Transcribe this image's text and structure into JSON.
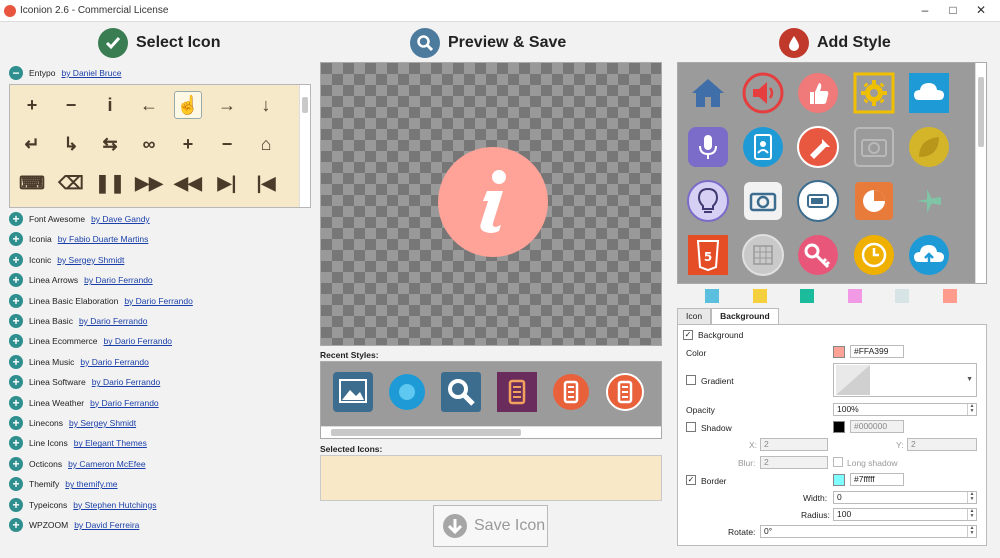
{
  "window": {
    "title": "Iconion 2.6 - Commercial License",
    "minimize": "–",
    "maximize": "□",
    "close": "✕"
  },
  "sections": {
    "select": "Select Icon",
    "preview": "Preview & Save",
    "style": "Add Style"
  },
  "icon_sets": [
    {
      "name": "Entypo",
      "author": "by Daniel Bruce",
      "expanded": true
    },
    {
      "name": "Font Awesome",
      "author": "by Dave Gandy"
    },
    {
      "name": "Iconia",
      "author": "by Fabio Duarte Martins"
    },
    {
      "name": "Iconic",
      "author": "by Sergey Shmidt"
    },
    {
      "name": "Linea Arrows",
      "author": "by Dario Ferrando"
    },
    {
      "name": "Linea Basic Elaboration",
      "author": "by Dario Ferrando"
    },
    {
      "name": "Linea Basic",
      "author": "by Dario Ferrando"
    },
    {
      "name": "Linea Ecommerce",
      "author": "by Dario Ferrando"
    },
    {
      "name": "Linea Music",
      "author": "by Dario Ferrando"
    },
    {
      "name": "Linea Software",
      "author": "by Dario Ferrando"
    },
    {
      "name": "Linea Weather",
      "author": "by Dario Ferrando"
    },
    {
      "name": "Linecons",
      "author": "by Sergey Shmidt"
    },
    {
      "name": "Line Icons",
      "author": "by Elegant Themes"
    },
    {
      "name": "Octicons",
      "author": "by Cameron McEfee"
    },
    {
      "name": "Themify",
      "author": "by themify.me"
    },
    {
      "name": "Typeicons",
      "author": "by Stephen Hutchings"
    },
    {
      "name": "WPZOOM",
      "author": "by David Ferreira"
    }
  ],
  "entypo_glyphs": [
    "plus-icon",
    "minus-icon",
    "info-icon",
    "arrow-left-icon",
    "hand-pointer-icon",
    "arrow-right-icon",
    "arrow-down-icon",
    "return-icon",
    "forward-icon",
    "swap-icon",
    "infinity-icon",
    "square-plus-icon",
    "square-minus-icon",
    "home-icon",
    "keyboard-icon",
    "backspace-icon",
    "pause-icon",
    "fast-forward-icon",
    "rewind-icon",
    "next-track-icon",
    "previous-track-icon"
  ],
  "entypo_chars": [
    "+",
    "−",
    "i",
    "←",
    "☝",
    "→",
    "↓",
    "↵",
    "↳",
    "⇆",
    "∞",
    "+",
    "−",
    "⌂",
    "⌨",
    "⌫",
    "❚❚",
    "▶▶",
    "◀◀",
    "▶|",
    "|◀"
  ],
  "preview": {
    "recent_label": "Recent Styles:",
    "selected_label": "Selected Icons:",
    "save_label": "Save Icon"
  },
  "colors": {
    "accent": "#ffa399",
    "border": "#7fffff",
    "shadow": "#000000",
    "panel_bg": "#f5e9c9"
  },
  "style_swatches": [
    "#5bc0de",
    "#f4d03f",
    "#1abc9c",
    "#f199e5",
    "#d6e4e5",
    "#ff9c8e"
  ],
  "tabs": [
    "Icon",
    "Background"
  ],
  "background": {
    "background_label": "Background",
    "color_label": "Color",
    "color_value": "#FFA399",
    "gradient_label": "Gradient",
    "opacity_label": "Opacity",
    "opacity_value": "100%",
    "shadow_label": "Shadow",
    "shadow_color": "#000000",
    "x_label": "X:",
    "x_value": "2",
    "y_label": "Y:",
    "y_value": "2",
    "blur_label": "Blur:",
    "blur_value": "2",
    "long_shadow_label": "Long shadow",
    "border_label": "Border",
    "border_color": "#7fffff",
    "width_label": "Width:",
    "width_value": "0",
    "radius_label": "Radius:",
    "radius_value": "100",
    "rotate_label": "Rotate:",
    "rotate_value": "0°"
  }
}
